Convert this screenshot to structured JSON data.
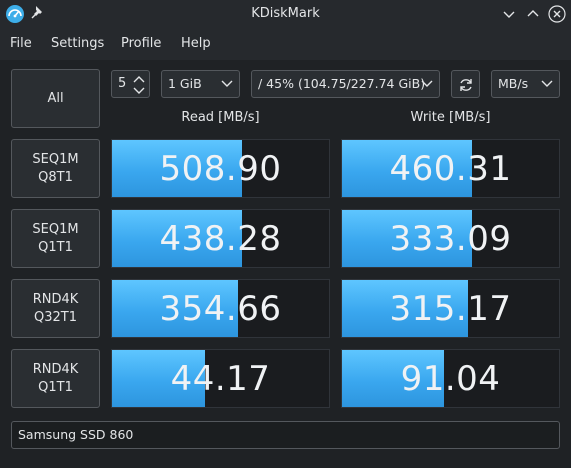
{
  "window": {
    "title": "KDiskMark"
  },
  "menu": [
    "File",
    "Settings",
    "Profile",
    "Help"
  ],
  "toolbar": {
    "all_label": "All",
    "runs": "5",
    "size": "1 GiB",
    "disk": "/ 45% (104.75/227.74 GiB)",
    "unit": "MB/s"
  },
  "headers": {
    "read": "Read [MB/s]",
    "write": "Write [MB/s]"
  },
  "tests": [
    {
      "line1": "SEQ1M",
      "line2": "Q8T1",
      "read": "508.90",
      "write": "460.31",
      "read_fill": 0.6,
      "write_fill": 0.6
    },
    {
      "line1": "SEQ1M",
      "line2": "Q1T1",
      "read": "438.28",
      "write": "333.09",
      "read_fill": 0.6,
      "write_fill": 0.6
    },
    {
      "line1": "RND4K",
      "line2": "Q32T1",
      "read": "354.66",
      "write": "315.17",
      "read_fill": 0.58,
      "write_fill": 0.58
    },
    {
      "line1": "RND4K",
      "line2": "Q1T1",
      "read": "44.17",
      "write": "91.04",
      "read_fill": 0.43,
      "write_fill": 0.47
    }
  ],
  "comment": "Samsung SSD 860",
  "colors": {
    "bar": "#3daee9",
    "background": "#1f2225"
  }
}
